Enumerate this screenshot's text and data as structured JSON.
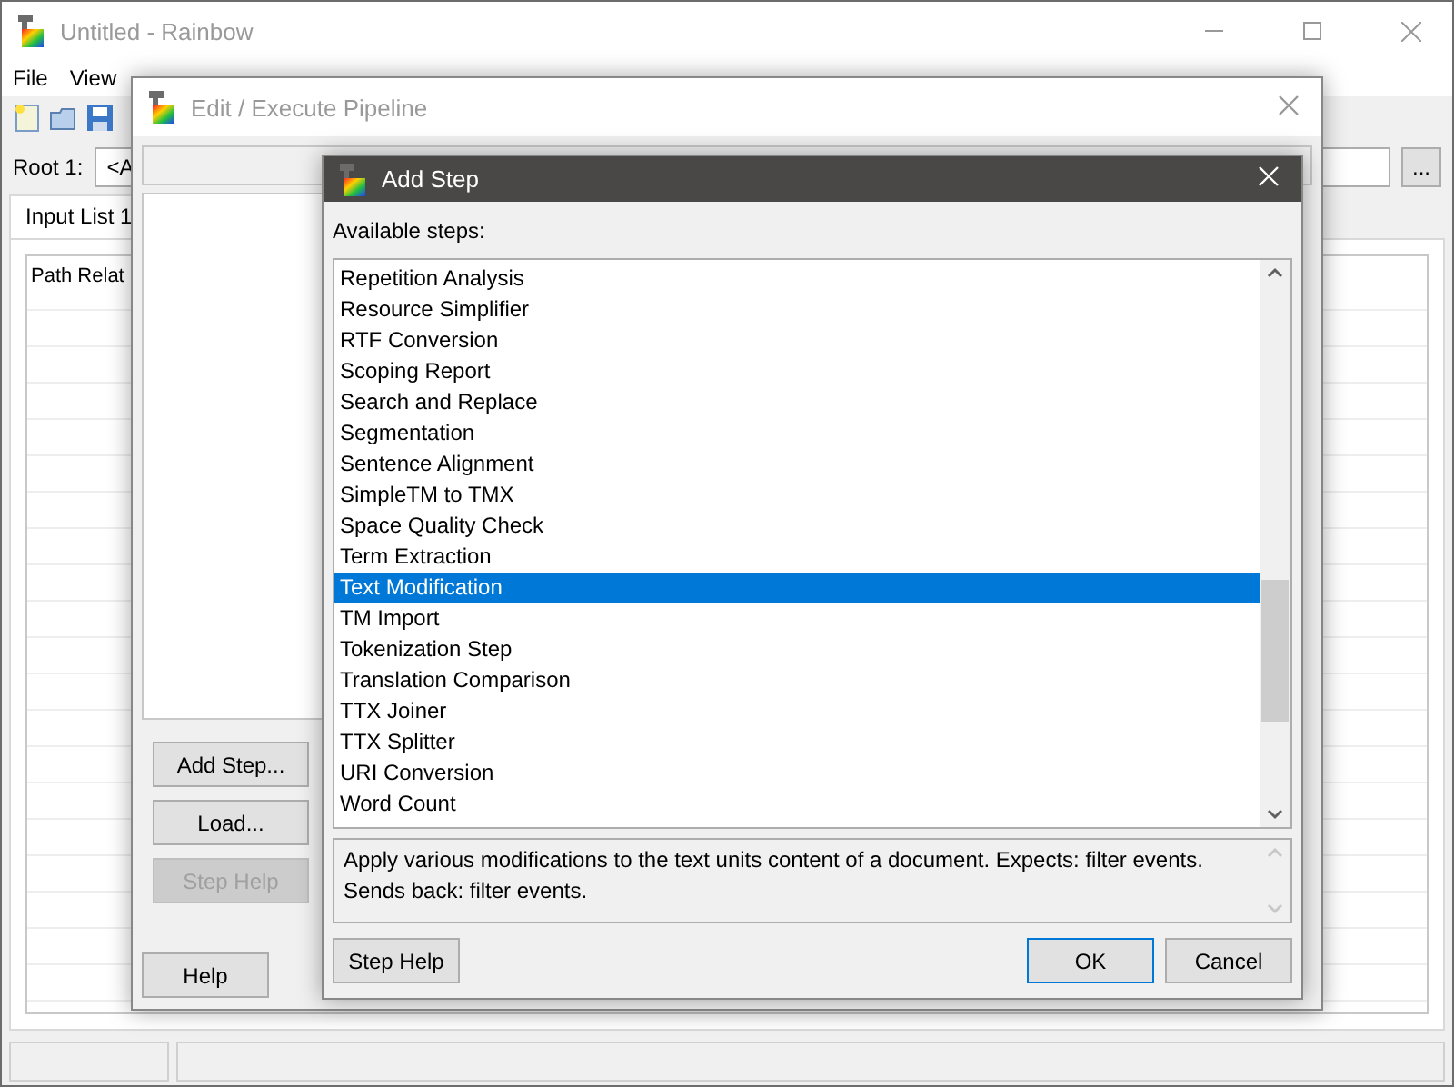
{
  "main_window": {
    "title": "Untitled - Rainbow",
    "menu": [
      "File",
      "View"
    ],
    "root_label": "Root 1:",
    "root_value": "<A",
    "browse_button": "...",
    "tab": {
      "label": "Input List 1",
      "selected": true
    },
    "table": {
      "columns": [
        "Path Relat"
      ]
    }
  },
  "pipeline_dialog": {
    "title": "Edit / Execute Pipeline",
    "buttons": [
      {
        "label": "Add Step...",
        "disabled": false
      },
      {
        "label": "Load...",
        "disabled": false
      },
      {
        "label": "Step Help",
        "disabled": true
      }
    ],
    "help_button": "Help"
  },
  "add_step_dialog": {
    "title": "Add Step",
    "list_label": "Available steps:",
    "steps": [
      {
        "label": "Repetition Analysis",
        "selected": false
      },
      {
        "label": "Resource Simplifier",
        "selected": false
      },
      {
        "label": "RTF Conversion",
        "selected": false
      },
      {
        "label": "Scoping Report",
        "selected": false
      },
      {
        "label": "Search and Replace",
        "selected": false
      },
      {
        "label": "Segmentation",
        "selected": false
      },
      {
        "label": "Sentence Alignment",
        "selected": false
      },
      {
        "label": "SimpleTM to TMX",
        "selected": false
      },
      {
        "label": "Space Quality Check",
        "selected": false
      },
      {
        "label": "Term Extraction",
        "selected": false
      },
      {
        "label": "Text Modification",
        "selected": true
      },
      {
        "label": "TM Import",
        "selected": false
      },
      {
        "label": "Tokenization Step",
        "selected": false
      },
      {
        "label": "Translation Comparison",
        "selected": false
      },
      {
        "label": "TTX Joiner",
        "selected": false
      },
      {
        "label": "TTX Splitter",
        "selected": false
      },
      {
        "label": "URI Conversion",
        "selected": false
      },
      {
        "label": "Word Count",
        "selected": false
      }
    ],
    "description": "Apply various modifications to the text units content of a document. Expects: filter events. Sends back: filter events.",
    "step_help_button": "Step Help",
    "ok_button": "OK",
    "cancel_button": "Cancel"
  }
}
